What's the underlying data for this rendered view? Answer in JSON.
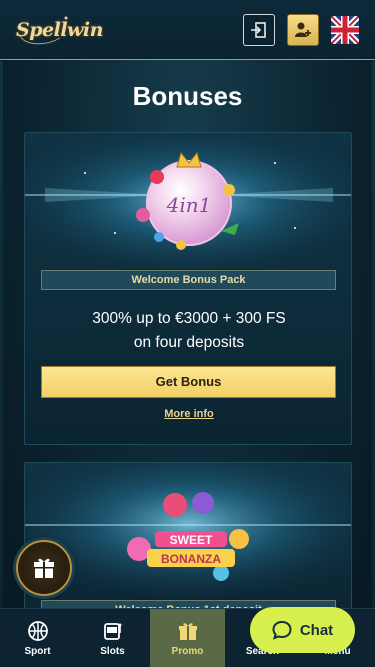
{
  "header": {
    "logo_text": "Spellwin",
    "login_icon": "login-icon",
    "register_icon": "add-user-icon",
    "language_icon": "uk-flag-icon"
  },
  "page": {
    "title": "Bonuses"
  },
  "bonuses": [
    {
      "label": "Welcome Bonus Pack",
      "banner_text": "4in1",
      "description_line1": "300% up to €3000 + 300 FS",
      "description_line2": "on four deposits",
      "button_label": "Get Bonus",
      "more_info_label": "More info"
    },
    {
      "label": "Welcome Bonus 1st deposit",
      "banner_text_1": "SWEET",
      "banner_text_2": "BONANZA"
    }
  ],
  "bottom_nav": {
    "items": [
      {
        "label": "Sport",
        "icon": "basketball-icon"
      },
      {
        "label": "Slots",
        "icon": "slot-machine-icon"
      },
      {
        "label": "Promo",
        "icon": "gift-icon"
      },
      {
        "label": "Search",
        "icon": "search-icon"
      },
      {
        "label": "Menu",
        "icon": "menu-icon"
      }
    ],
    "active": "Promo"
  },
  "chat": {
    "label": "Chat",
    "icon": "chat-bubble-icon"
  },
  "colors": {
    "accent_gold": "#f3cf68",
    "chat_green": "#d8f04d",
    "background": "#0a2230"
  }
}
